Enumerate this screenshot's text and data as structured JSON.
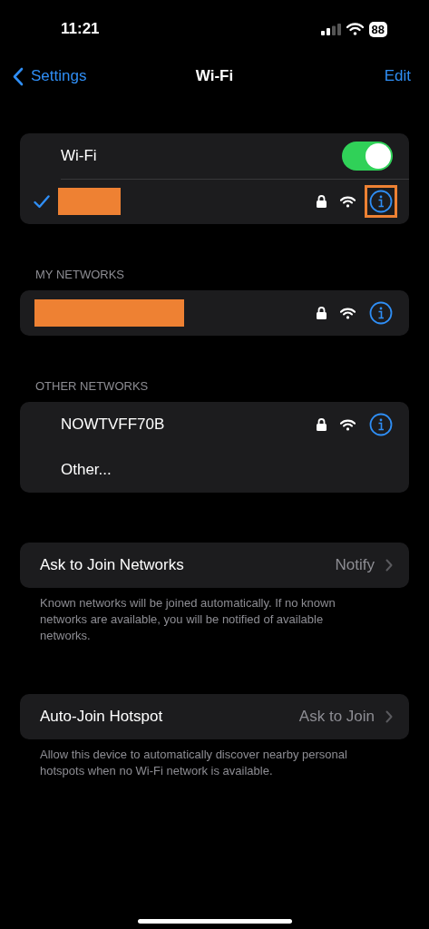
{
  "status_bar": {
    "time": "11:21",
    "battery": "88"
  },
  "nav": {
    "back": "Settings",
    "title": "Wi-Fi",
    "action": "Edit"
  },
  "wifi": {
    "label": "Wi-Fi",
    "on": true,
    "connected": {
      "kind": "redacted",
      "checked": true,
      "locked": true,
      "highlighted": true
    }
  },
  "my_networks": {
    "header": "MY NETWORKS",
    "networks": [
      {
        "kind": "redacted",
        "locked": true,
        "highlighted": false
      }
    ]
  },
  "other_networks": {
    "header": "OTHER NETWORKS",
    "networks": [
      {
        "name": "NOWTVFF70B",
        "locked": true,
        "highlighted": false
      }
    ],
    "other": "Other..."
  },
  "settings": [
    {
      "label": "Ask to Join Networks",
      "value": "Notify",
      "footnote": "Known networks will be joined automatically. If no known networks are available, you will be notified of available networks."
    },
    {
      "label": "Auto-Join Hotspot",
      "value": "Ask to Join",
      "footnote": "Allow this device to automatically discover nearby personal hotspots when no Wi-Fi network is available."
    }
  ]
}
